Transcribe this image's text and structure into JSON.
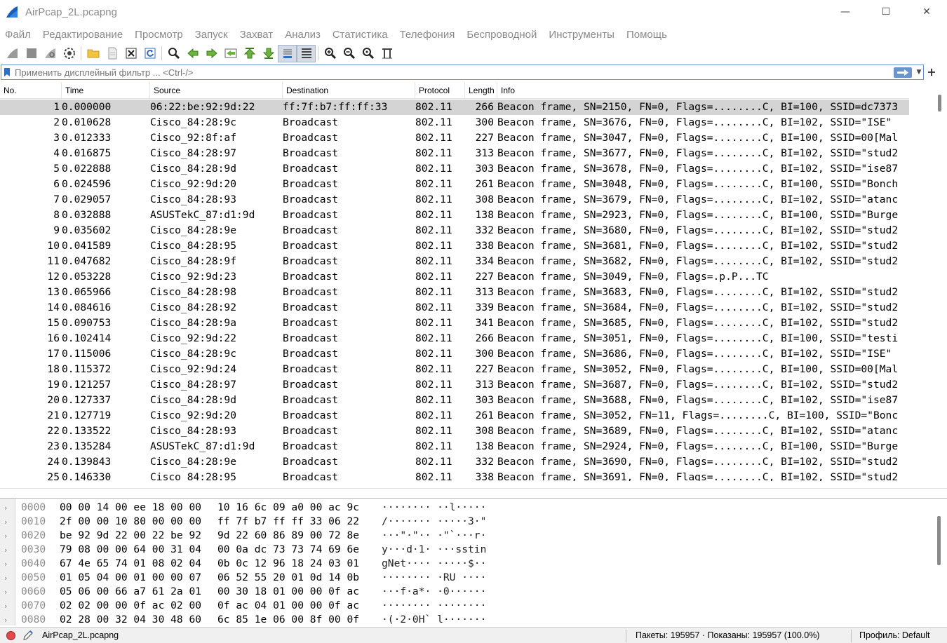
{
  "window": {
    "title": "AirPcap_2L.pcapng",
    "minimize_glyph": "—",
    "maximize_glyph": "☐",
    "close_glyph": "✕"
  },
  "menu": [
    "Файл",
    "Редактирование",
    "Просмотр",
    "Запуск",
    "Захват",
    "Анализ",
    "Статистика",
    "Телефония",
    "Беспроводной",
    "Инструменты",
    "Помощь"
  ],
  "filter": {
    "placeholder": "Применить дисплейный фильтр ... <Ctrl-/>",
    "plus_glyph": "+"
  },
  "columns": [
    "No.",
    "Time",
    "Source",
    "Destination",
    "Protocol",
    "Length",
    "Info"
  ],
  "packets": [
    {
      "no": "1",
      "time": "0.000000",
      "src": "06:22:be:92:9d:22",
      "dst": "ff:7f:b7:ff:ff:33",
      "proto": "802.11",
      "len": "266",
      "info": "Beacon frame, SN=2150, FN=0, Flags=........C, BI=100, SSID=dc7373"
    },
    {
      "no": "2",
      "time": "0.010628",
      "src": "Cisco_84:28:9c",
      "dst": "Broadcast",
      "proto": "802.11",
      "len": "300",
      "info": "Beacon frame, SN=3676, FN=0, Flags=........C, BI=102, SSID=\"ISE\""
    },
    {
      "no": "3",
      "time": "0.012333",
      "src": "Cisco_92:8f:af",
      "dst": "Broadcast",
      "proto": "802.11",
      "len": "227",
      "info": "Beacon frame, SN=3047, FN=0, Flags=........C, BI=100, SSID=00[Mal"
    },
    {
      "no": "4",
      "time": "0.016875",
      "src": "Cisco_84:28:97",
      "dst": "Broadcast",
      "proto": "802.11",
      "len": "313",
      "info": "Beacon frame, SN=3677, FN=0, Flags=........C, BI=102, SSID=\"stud2"
    },
    {
      "no": "5",
      "time": "0.022888",
      "src": "Cisco_84:28:9d",
      "dst": "Broadcast",
      "proto": "802.11",
      "len": "303",
      "info": "Beacon frame, SN=3678, FN=0, Flags=........C, BI=102, SSID=\"ise87"
    },
    {
      "no": "6",
      "time": "0.024596",
      "src": "Cisco_92:9d:20",
      "dst": "Broadcast",
      "proto": "802.11",
      "len": "261",
      "info": "Beacon frame, SN=3048, FN=0, Flags=........C, BI=100, SSID=\"Bonch"
    },
    {
      "no": "7",
      "time": "0.029057",
      "src": "Cisco_84:28:93",
      "dst": "Broadcast",
      "proto": "802.11",
      "len": "308",
      "info": "Beacon frame, SN=3679, FN=0, Flags=........C, BI=102, SSID=\"atanc"
    },
    {
      "no": "8",
      "time": "0.032888",
      "src": "ASUSTekC_87:d1:9d",
      "dst": "Broadcast",
      "proto": "802.11",
      "len": "138",
      "info": "Beacon frame, SN=2923, FN=0, Flags=........C, BI=100, SSID=\"Burge"
    },
    {
      "no": "9",
      "time": "0.035602",
      "src": "Cisco_84:28:9e",
      "dst": "Broadcast",
      "proto": "802.11",
      "len": "332",
      "info": "Beacon frame, SN=3680, FN=0, Flags=........C, BI=102, SSID=\"stud2"
    },
    {
      "no": "10",
      "time": "0.041589",
      "src": "Cisco_84:28:95",
      "dst": "Broadcast",
      "proto": "802.11",
      "len": "338",
      "info": "Beacon frame, SN=3681, FN=0, Flags=........C, BI=102, SSID=\"stud2"
    },
    {
      "no": "11",
      "time": "0.047682",
      "src": "Cisco_84:28:9f",
      "dst": "Broadcast",
      "proto": "802.11",
      "len": "334",
      "info": "Beacon frame, SN=3682, FN=0, Flags=........C, BI=102, SSID=\"stud2"
    },
    {
      "no": "12",
      "time": "0.053228",
      "src": "Cisco_92:9d:23",
      "dst": "Broadcast",
      "proto": "802.11",
      "len": "227",
      "info": "Beacon frame, SN=3049, FN=0, Flags=.p.P...TC"
    },
    {
      "no": "13",
      "time": "0.065966",
      "src": "Cisco_84:28:98",
      "dst": "Broadcast",
      "proto": "802.11",
      "len": "313",
      "info": "Beacon frame, SN=3683, FN=0, Flags=........C, BI=102, SSID=\"stud2"
    },
    {
      "no": "14",
      "time": "0.084616",
      "src": "Cisco_84:28:92",
      "dst": "Broadcast",
      "proto": "802.11",
      "len": "339",
      "info": "Beacon frame, SN=3684, FN=0, Flags=........C, BI=102, SSID=\"stud2"
    },
    {
      "no": "15",
      "time": "0.090753",
      "src": "Cisco_84:28:9a",
      "dst": "Broadcast",
      "proto": "802.11",
      "len": "341",
      "info": "Beacon frame, SN=3685, FN=0, Flags=........C, BI=102, SSID=\"stud2"
    },
    {
      "no": "16",
      "time": "0.102414",
      "src": "Cisco_92:9d:22",
      "dst": "Broadcast",
      "proto": "802.11",
      "len": "266",
      "info": "Beacon frame, SN=3051, FN=0, Flags=........C, BI=100, SSID=\"testi"
    },
    {
      "no": "17",
      "time": "0.115006",
      "src": "Cisco_84:28:9c",
      "dst": "Broadcast",
      "proto": "802.11",
      "len": "300",
      "info": "Beacon frame, SN=3686, FN=0, Flags=........C, BI=102, SSID=\"ISE\""
    },
    {
      "no": "18",
      "time": "0.115372",
      "src": "Cisco_92:9d:24",
      "dst": "Broadcast",
      "proto": "802.11",
      "len": "227",
      "info": "Beacon frame, SN=3052, FN=0, Flags=........C, BI=100, SSID=00[Mal"
    },
    {
      "no": "19",
      "time": "0.121257",
      "src": "Cisco_84:28:97",
      "dst": "Broadcast",
      "proto": "802.11",
      "len": "313",
      "info": "Beacon frame, SN=3687, FN=0, Flags=........C, BI=102, SSID=\"stud2"
    },
    {
      "no": "20",
      "time": "0.127337",
      "src": "Cisco_84:28:9d",
      "dst": "Broadcast",
      "proto": "802.11",
      "len": "303",
      "info": "Beacon frame, SN=3688, FN=0, Flags=........C, BI=102, SSID=\"ise87"
    },
    {
      "no": "21",
      "time": "0.127719",
      "src": "Cisco_92:9d:20",
      "dst": "Broadcast",
      "proto": "802.11",
      "len": "261",
      "info": "Beacon frame, SN=3052, FN=11, Flags=........C, BI=100, SSID=\"Bonc"
    },
    {
      "no": "22",
      "time": "0.133522",
      "src": "Cisco_84:28:93",
      "dst": "Broadcast",
      "proto": "802.11",
      "len": "308",
      "info": "Beacon frame, SN=3689, FN=0, Flags=........C, BI=102, SSID=\"atanc"
    },
    {
      "no": "23",
      "time": "0.135284",
      "src": "ASUSTekC_87:d1:9d",
      "dst": "Broadcast",
      "proto": "802.11",
      "len": "138",
      "info": "Beacon frame, SN=2924, FN=0, Flags=........C, BI=100, SSID=\"Burge"
    },
    {
      "no": "24",
      "time": "0.139843",
      "src": "Cisco_84:28:9e",
      "dst": "Broadcast",
      "proto": "802.11",
      "len": "332",
      "info": "Beacon frame, SN=3690, FN=0, Flags=........C, BI=102, SSID=\"stud2"
    },
    {
      "no": "25",
      "time": "0.146330",
      "src": "Cisco_84:28:95",
      "dst": "Broadcast",
      "proto": "802.11",
      "len": "338",
      "info": "Beacon frame, SN=3691, FN=0, Flags=........C, BI=102, SSID=\"stud2"
    }
  ],
  "bytes": [
    {
      "off": "0000",
      "hex1": "00 00 14 00 ee 18 00 00",
      "hex2": "10 16 6c 09 a0 00 ac 9c",
      "ascii": "········ ··l·····"
    },
    {
      "off": "0010",
      "hex1": "2f 00 00 10 80 00 00 00",
      "hex2": "ff 7f b7 ff ff 33 06 22",
      "ascii": "/······· ·····3·\""
    },
    {
      "off": "0020",
      "hex1": "be 92 9d 22 00 22 be 92",
      "hex2": "9d 22 60 86 89 00 72 8e",
      "ascii": "···\"·\"·· ·\"`···r·"
    },
    {
      "off": "0030",
      "hex1": "79 08 00 00 64 00 31 04",
      "hex2": "00 0a dc 73 73 74 69 6e",
      "ascii": "y···d·1· ···sstin"
    },
    {
      "off": "0040",
      "hex1": "67 4e 65 74 01 08 02 04",
      "hex2": "0b 0c 12 96 18 24 03 01",
      "ascii": "gNet···· ·····$··"
    },
    {
      "off": "0050",
      "hex1": "01 05 04 00 01 00 00 07",
      "hex2": "06 52 55 20 01 0d 14 0b",
      "ascii": "········ ·RU ····"
    },
    {
      "off": "0060",
      "hex1": "05 06 00 66 a7 61 2a 01",
      "hex2": "00 30 18 01 00 00 0f ac",
      "ascii": "···f·a*· ·0······"
    },
    {
      "off": "0070",
      "hex1": "02 02 00 00 0f ac 02 00",
      "hex2": "0f ac 04 01 00 00 0f ac",
      "ascii": "········ ········"
    },
    {
      "off": "0080",
      "hex1": "02 28 00 32 04 30 48 60",
      "hex2": "6c 85 1e 06 00 8f 00 0f",
      "ascii": "·(·2·0H` l·······"
    }
  ],
  "status": {
    "file": "AirPcap_2L.pcapng",
    "stats": "Пакеты: 195957 · Показаны: 195957 (100.0%)",
    "profile": "Профиль: Default"
  },
  "selected_row_index": 0,
  "colors": {
    "accent": "#6b95cf",
    "selected_row": "#d4d4d4",
    "stop_led": "#e04a4a"
  }
}
